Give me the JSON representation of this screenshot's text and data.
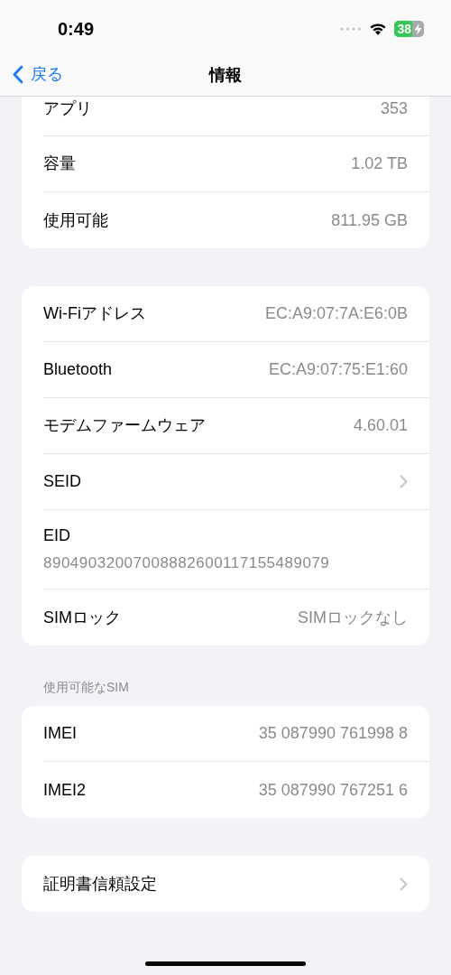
{
  "status_bar": {
    "time": "0:49",
    "battery": "38",
    "charging": true
  },
  "nav": {
    "back": "戻る",
    "title": "情報"
  },
  "groups": [
    {
      "rows": [
        {
          "kind": "value",
          "label": "アプリ",
          "value": "353"
        },
        {
          "kind": "value",
          "label": "容量",
          "value": "1.02 TB"
        },
        {
          "kind": "value",
          "label": "使用可能",
          "value": "811.95 GB"
        }
      ]
    },
    {
      "rows": [
        {
          "kind": "value",
          "label": "Wi-Fiアドレス",
          "value": "EC:A9:07:7A:E6:0B"
        },
        {
          "kind": "value",
          "label": "Bluetooth",
          "value": "EC:A9:07:75:E1:60"
        },
        {
          "kind": "value",
          "label": "モデムファームウェア",
          "value": "4.60.01"
        },
        {
          "kind": "chevron",
          "label": "SEID"
        },
        {
          "kind": "stacked",
          "label": "EID",
          "value": "89049032007008882600117155489079"
        },
        {
          "kind": "value",
          "label": "SIMロック",
          "value": "SIMロックなし"
        }
      ]
    },
    {
      "header": "使用可能なSIM",
      "rows": [
        {
          "kind": "value",
          "label": "IMEI",
          "value": "35 087990 761998 8"
        },
        {
          "kind": "value",
          "label": "IMEI2",
          "value": "35 087990 767251 6"
        }
      ]
    },
    {
      "rows": [
        {
          "kind": "chevron",
          "label": "証明書信頼設定"
        }
      ]
    }
  ]
}
